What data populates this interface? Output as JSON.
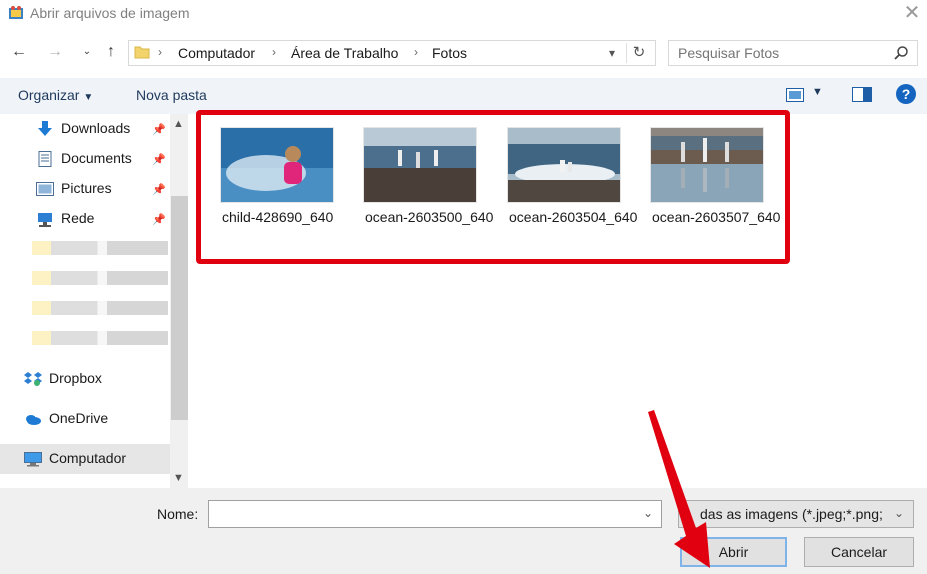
{
  "window": {
    "title": "Abrir arquivos de imagem"
  },
  "address": {
    "crumbs": [
      "Computador",
      "Área de Trabalho",
      "Fotos"
    ]
  },
  "search": {
    "placeholder": "Pesquisar Fotos"
  },
  "toolbar": {
    "organize_label": "Organizar",
    "new_folder_label": "Nova pasta",
    "help_label": "?"
  },
  "nav": {
    "quick_access": [
      {
        "label": "Downloads",
        "icon": "download-arrow-icon"
      },
      {
        "label": "Documents",
        "icon": "document-icon"
      },
      {
        "label": "Pictures",
        "icon": "pictures-icon"
      },
      {
        "label": "Rede",
        "icon": "network-icon"
      }
    ],
    "other": [
      {
        "label": "Dropbox",
        "icon": "dropbox-icon"
      },
      {
        "label": "OneDrive",
        "icon": "onedrive-icon"
      },
      {
        "label": "Computador",
        "icon": "computer-icon"
      }
    ]
  },
  "files": [
    {
      "name": "child-428690_640"
    },
    {
      "name": "ocean-2603500_640"
    },
    {
      "name": "ocean-2603504_640"
    },
    {
      "name": "ocean-2603507_640"
    }
  ],
  "bottom": {
    "name_label": "Nome:",
    "name_value": "",
    "filter_text": "das as imagens (*.jpeg;*.png;",
    "open_label": "Abrir",
    "cancel_label": "Cancelar"
  },
  "colors": {
    "highlight": "#e0000f",
    "toolbar_bg": "#f0f4f9",
    "accent": "#1565c0"
  }
}
